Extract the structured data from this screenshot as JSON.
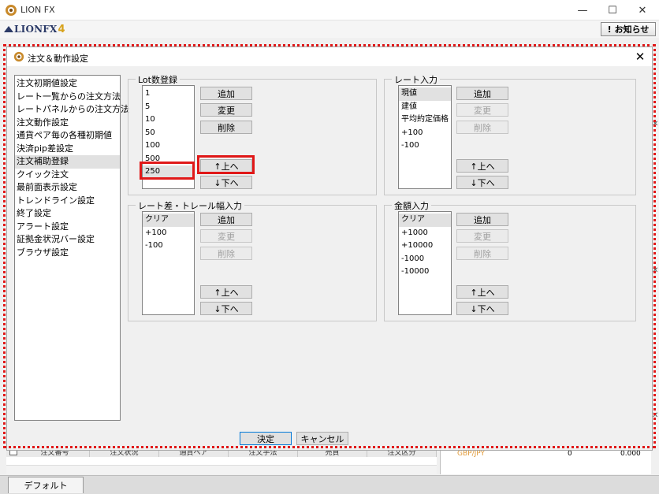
{
  "app": {
    "title": "LION FX",
    "logo_text": "LIONFX",
    "logo_version": "4",
    "notice_button": "お知らせ",
    "window_controls": {
      "minimize": "—",
      "maximize": "☐",
      "close": "✕"
    }
  },
  "background": {
    "order_columns": [
      "注文番号",
      "注文状況",
      "通貨ペア",
      "注文手法",
      "売買",
      "注文区分"
    ],
    "rate_row": {
      "pair": "GBP/JPY",
      "value": "0",
      "price": "0.000"
    },
    "tab_label": "デフォルト"
  },
  "dialog": {
    "title": "注文＆動作設定",
    "close": "✕",
    "nav": [
      "注文初期値設定",
      "レート一覧からの注文方法",
      "レートパネルからの注文方法",
      "注文動作設定",
      "通貨ペア毎の各種初期値",
      "決済pip差設定",
      "注文補助登録",
      "クイック注文",
      "最前面表示設定",
      "トレンドライン設定",
      "終了設定",
      "アラート設定",
      "証拠金状況バー設定",
      "ブラウザ設定"
    ],
    "nav_selected_index": 6,
    "lot": {
      "label": "Lot数登録",
      "items": [
        "1",
        "5",
        "10",
        "50",
        "100",
        "500",
        "250"
      ],
      "selected_index": 6,
      "buttons": {
        "add": "追加",
        "change": "変更",
        "delete": "削除",
        "up": "↑上へ",
        "down": "↓下へ"
      }
    },
    "rate": {
      "label": "レート入力",
      "items": [
        "現値",
        "建値",
        "平均約定価格",
        "+100",
        "-100"
      ],
      "selected_index": 0,
      "buttons": {
        "add": "追加",
        "change": "変更",
        "delete": "削除",
        "up": "↑上へ",
        "down": "↓下へ"
      }
    },
    "trail": {
      "label": "レート差・トレール幅入力",
      "items": [
        "クリア",
        "+100",
        "-100"
      ],
      "selected_index": 0,
      "buttons": {
        "add": "追加",
        "change": "変更",
        "delete": "削除",
        "up": "↑上へ",
        "down": "↓下へ"
      }
    },
    "amount": {
      "label": "金額入力",
      "items": [
        "クリア",
        "+1000",
        "+10000",
        "-1000",
        "-10000"
      ],
      "selected_index": 0,
      "buttons": {
        "add": "追加",
        "change": "変更",
        "delete": "削除",
        "up": "↑上へ",
        "down": "↓下へ"
      }
    },
    "ok": "決定",
    "cancel": "キャンセル"
  }
}
